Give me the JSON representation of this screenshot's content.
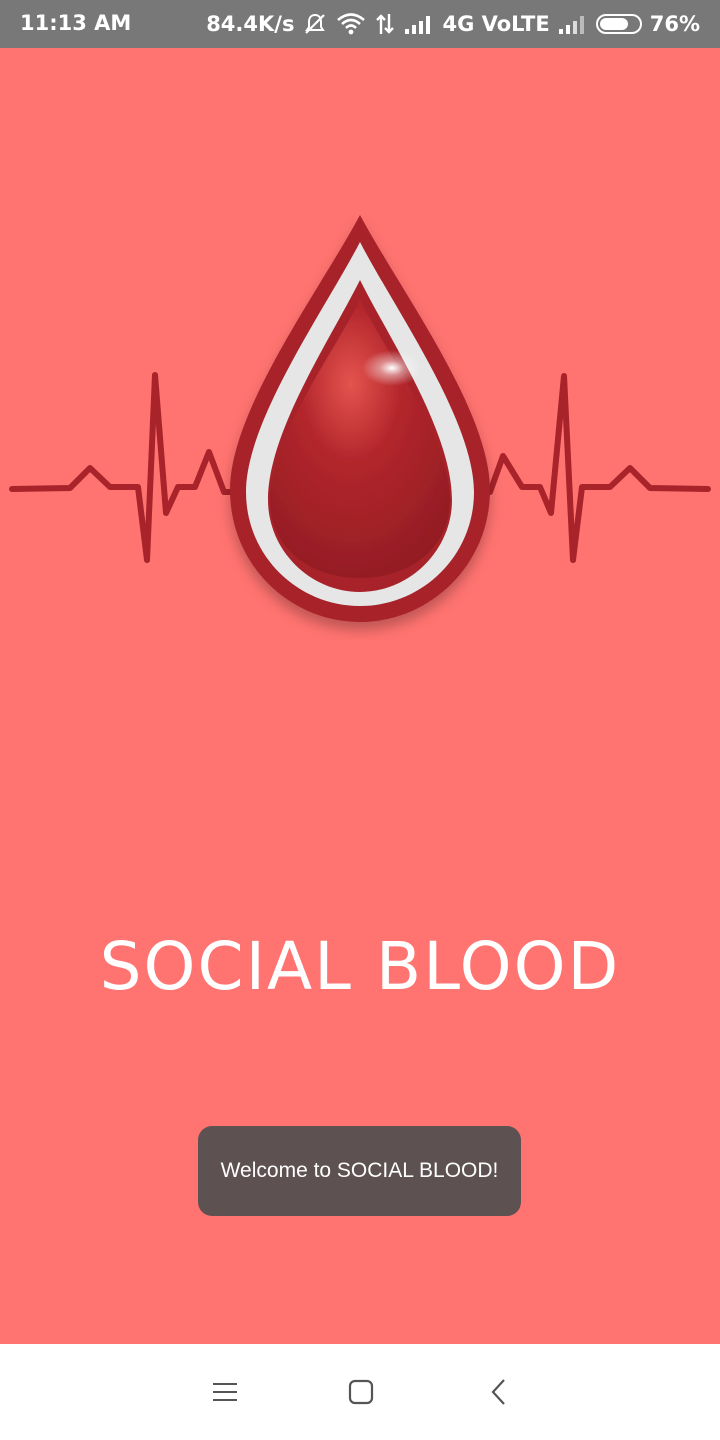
{
  "status_bar": {
    "time": "11:13 AM",
    "net_speed": "84.4K/s",
    "network_type": "4G VoLTE",
    "battery_percent": "76%",
    "battery_level": 0.76,
    "icons": [
      "notifications-off-icon",
      "wifi-icon",
      "data-transfer-icon",
      "signal-icon",
      "signal-icon-2",
      "battery-icon"
    ]
  },
  "splash": {
    "logo_icon": "blood-drop-heartbeat-logo",
    "title": "SOCIAL BLOOD"
  },
  "toast": {
    "message": "Welcome to SOCIAL BLOOD!"
  },
  "nav_bar": {
    "icons": [
      "menu-icon",
      "home-icon",
      "back-icon"
    ]
  },
  "colors": {
    "background": "#ff7370",
    "status_bar": "#787878",
    "drop_red": "#b0252d",
    "toast_bg": "#5d5152"
  }
}
